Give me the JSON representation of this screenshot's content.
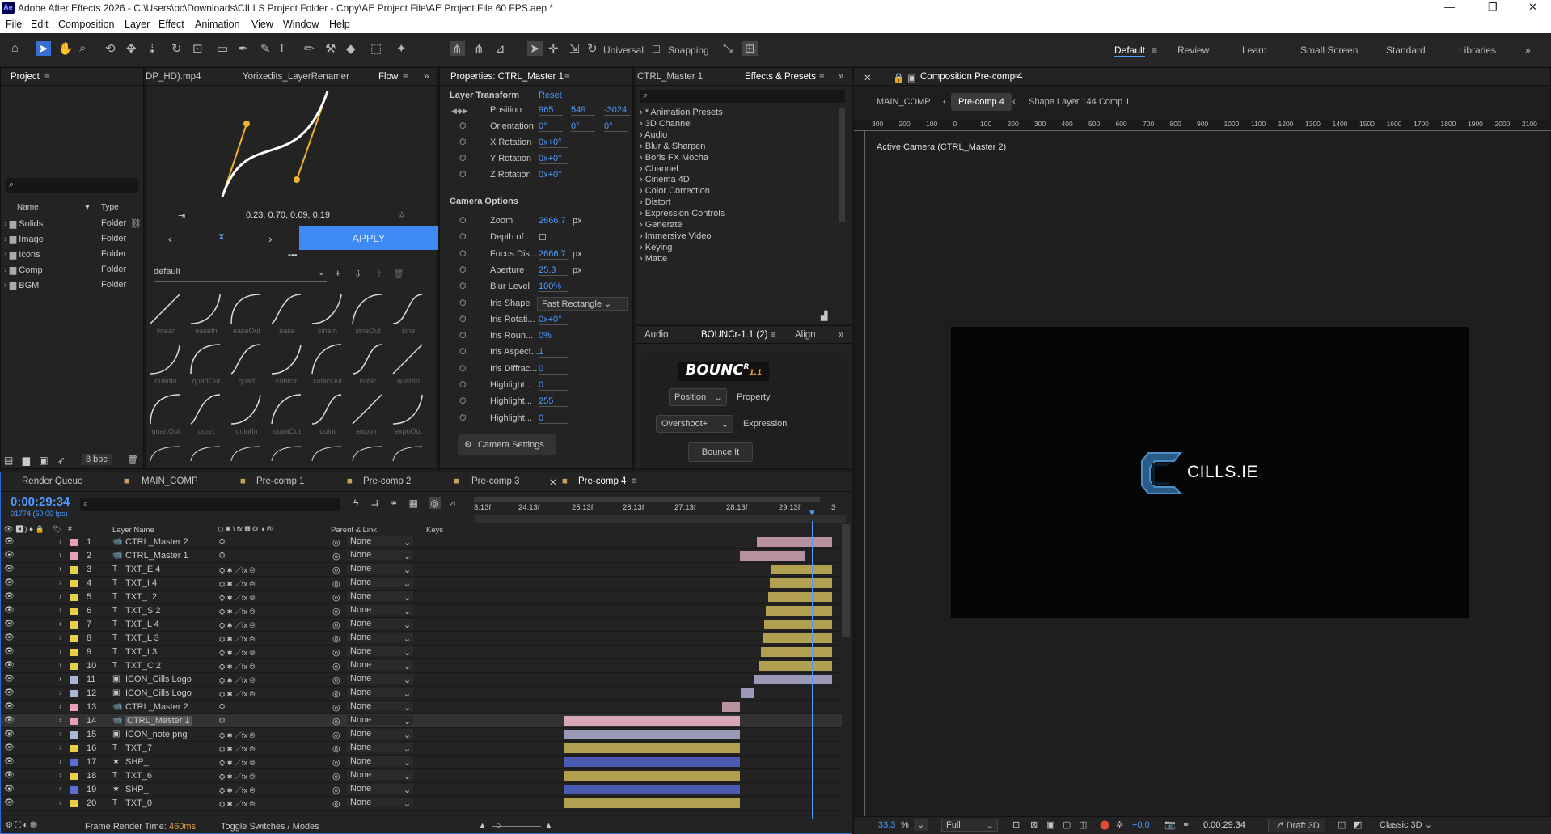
{
  "app": {
    "title": "Adobe After Effects 2026 - C:\\Users\\pc\\Downloads\\CILLS Project Folder - Copy\\AE Project File\\AE Project File 60 FPS.aep *",
    "logo": "Ae"
  },
  "menu": [
    "File",
    "Edit",
    "Composition",
    "Layer",
    "Effect",
    "Animation",
    "View",
    "Window",
    "Help"
  ],
  "toolbar": {
    "universal": "Universal",
    "snapping": "Snapping"
  },
  "workspaces": [
    "Default",
    "Review",
    "Learn",
    "Small Screen",
    "Standard",
    "Libraries"
  ],
  "project": {
    "title": "Project",
    "col_name": "Name",
    "col_type": "Type",
    "items": [
      {
        "name": "Solids",
        "type": "Folder"
      },
      {
        "name": "Image",
        "type": "Folder"
      },
      {
        "name": "Icons",
        "type": "Folder"
      },
      {
        "name": "Comp",
        "type": "Folder"
      },
      {
        "name": "BGM",
        "type": "Folder"
      }
    ],
    "bpc": "8 bpc"
  },
  "flow": {
    "tabs": [
      "DP_HD).mp4",
      "Yorixedits_LayerRenamer",
      "Flow"
    ],
    "values": "0.23, 0.70, 0.69, 0.19",
    "apply": "APPLY",
    "preset": "default",
    "row1": [
      "linear",
      "easeIn",
      "easeOut",
      "ease",
      "sineIn",
      "sineOut",
      "sine"
    ],
    "row2": [
      "quadIn",
      "quadOut",
      "quad",
      "cubicIn",
      "cubicOut",
      "cubic",
      "quartIn"
    ],
    "row3": [
      "quartOut",
      "quart",
      "quintIn",
      "quintOut",
      "quint",
      "expoIn",
      "expoOut"
    ]
  },
  "props": {
    "title": "Properties: CTRL_Master 1",
    "section1": "Layer Transform",
    "reset": "Reset",
    "position_label": "Position",
    "pos": [
      "965",
      "549",
      "-3024"
    ],
    "orientation_label": "Orientation",
    "orient": [
      "0°",
      "0°",
      "0°"
    ],
    "xrot_label": "X Rotation",
    "xrot": "0x+0°",
    "yrot_label": "Y Rotation",
    "yrot": "0x+0°",
    "zrot_label": "Z Rotation",
    "zrot": "0x+0°",
    "section2": "Camera Options",
    "zoom_label": "Zoom",
    "zoom": "2666.7",
    "px": "px",
    "dof_label": "Depth of ...",
    "focus_label": "Focus Dis...",
    "focus": "2666.7",
    "aperture_label": "Aperture",
    "aperture": "25.3",
    "blur_label": "Blur Level",
    "blur": "100%",
    "iris_label": "Iris Shape",
    "iris": "Fast Rectangle",
    "irot_label": "Iris Rotati...",
    "irot": "0x+0°",
    "iround_label": "Iris Roun...",
    "iround": "0%",
    "iaspect_label": "Iris Aspect...",
    "iaspect": "1",
    "idiff_label": "Iris Diffrac...",
    "idiff": "0",
    "h1_label": "Highlight...",
    "h1": "0",
    "h2_label": "Highlight...",
    "h2": "255",
    "h3_label": "Highlight...",
    "h3": "0",
    "camera_settings": "Camera Settings"
  },
  "effects": {
    "tab1": "CTRL_Master 1",
    "tab2": "Effects & Presets",
    "items": [
      "* Animation Presets",
      "3D Channel",
      "Audio",
      "Blur & Sharpen",
      "Boris FX Mocha",
      "Channel",
      "Cinema 4D",
      "Color Correction",
      "Distort",
      "Expression Controls",
      "Generate",
      "Immersive Video",
      "Keying",
      "Matte"
    ]
  },
  "bouncr": {
    "tabs": [
      "Audio",
      "BOUNCr-1.1 (2)",
      "Align"
    ],
    "logo": "BOUNC",
    "logo_sup": "R",
    "logo_ver": "1.1",
    "position": "Position",
    "property": "Property",
    "overshoot": "Overshoot+",
    "expression": "Expression",
    "bounce": "Bounce It"
  },
  "comp": {
    "title": "Composition Pre-comp 4",
    "crumbs": [
      "MAIN_COMP",
      "Pre-comp 4",
      "Shape Layer 144 Comp 1"
    ],
    "camera": "Active Camera (CTRL_Master 2)",
    "brand": "CILLS.IE",
    "ruler": [
      "300",
      "200",
      "100",
      "0",
      "100",
      "200",
      "300",
      "400",
      "500",
      "600",
      "700",
      "800",
      "900",
      "1000",
      "1100",
      "1200",
      "1300",
      "1400",
      "1500",
      "1600",
      "1700",
      "1800",
      "1900",
      "2000",
      "2100"
    ],
    "zoom": "33.3",
    "pct": "%",
    "quality": "Full",
    "timecode": "0:00:29:34",
    "draft": "Draft 3D",
    "renderer": "Classic 3D",
    "exposure": "+0.0"
  },
  "timeline": {
    "tabs": [
      "Render Queue",
      "MAIN_COMP",
      "Pre-comp 1",
      "Pre-comp 2",
      "Pre-comp 3",
      "Pre-comp 4"
    ],
    "timecode": "0:00:29:34",
    "frames": "01774 (60.00 fps)",
    "col_layer": "Layer Name",
    "col_parent": "Parent & Link",
    "col_keys": "Keys",
    "ticks": [
      "3:13f",
      "24:13f",
      "25:13f",
      "26:13f",
      "27:13f",
      "28:13f",
      "29:13f",
      "3"
    ],
    "parent_none": "None",
    "render_label": "Frame Render Time:",
    "render_time": "460ms",
    "toggle": "Toggle Switches / Modes",
    "layers": [
      {
        "n": "1",
        "name": "CTRL_Master 2",
        "color": "#e8a0b8",
        "icon": "cam"
      },
      {
        "n": "2",
        "name": "CTRL_Master 1",
        "color": "#e8a0b8",
        "icon": "cam"
      },
      {
        "n": "3",
        "name": "TXT_E 4",
        "color": "#e6d24a",
        "icon": "T"
      },
      {
        "n": "4",
        "name": "TXT_I 4",
        "color": "#e6d24a",
        "icon": "T"
      },
      {
        "n": "5",
        "name": "TXT_. 2",
        "color": "#e6d24a",
        "icon": "T"
      },
      {
        "n": "6",
        "name": "TXT_S 2",
        "color": "#e6d24a",
        "icon": "T"
      },
      {
        "n": "7",
        "name": "TXT_L 4",
        "color": "#e6d24a",
        "icon": "T"
      },
      {
        "n": "8",
        "name": "TXT_L 3",
        "color": "#e6d24a",
        "icon": "T"
      },
      {
        "n": "9",
        "name": "TXT_I 3",
        "color": "#e6d24a",
        "icon": "T"
      },
      {
        "n": "10",
        "name": "TXT_C 2",
        "color": "#e6d24a",
        "icon": "T"
      },
      {
        "n": "11",
        "name": "ICON_Cills Logo",
        "color": "#a9b6d6",
        "icon": "img"
      },
      {
        "n": "12",
        "name": "ICON_Cills Logo",
        "color": "#a9b6d6",
        "icon": "img"
      },
      {
        "n": "13",
        "name": "CTRL_Master 2",
        "color": "#e8a0b8",
        "icon": "cam"
      },
      {
        "n": "14",
        "name": "CTRL_Master 1",
        "color": "#e8a0b8",
        "icon": "cam"
      },
      {
        "n": "15",
        "name": "ICON_note.png",
        "color": "#a9b6d6",
        "icon": "img"
      },
      {
        "n": "16",
        "name": "TXT_7",
        "color": "#e6d24a",
        "icon": "T"
      },
      {
        "n": "17",
        "name": "SHP_",
        "color": "#5b6fd6",
        "icon": "star"
      },
      {
        "n": "18",
        "name": "TXT_6",
        "color": "#e6d24a",
        "icon": "T"
      },
      {
        "n": "19",
        "name": "SHP_",
        "color": "#5b6fd6",
        "icon": "star"
      },
      {
        "n": "20",
        "name": "TXT_0",
        "color": "#e6d24a",
        "icon": "T"
      }
    ]
  }
}
